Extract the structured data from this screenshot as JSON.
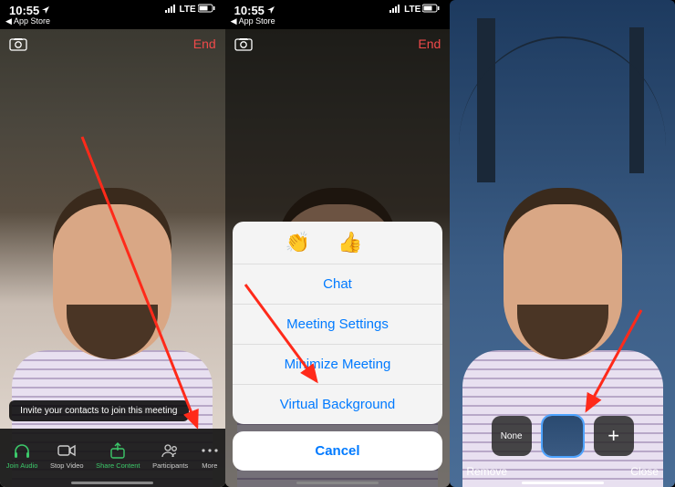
{
  "status": {
    "time": "10:55",
    "back_app": "App Store",
    "network": "LTE"
  },
  "topbar": {
    "end_label": "End"
  },
  "tooltip": "Invite your contacts to join this meeting",
  "toolbar": {
    "join_audio": "Join Audio",
    "stop_video": "Stop Video",
    "share_content": "Share Content",
    "participants": "Participants",
    "more": "More"
  },
  "sheet": {
    "emoji_clap": "👏",
    "emoji_thumbs": "👍",
    "chat": "Chat",
    "meeting_settings": "Meeting Settings",
    "minimize_meeting": "Minimize Meeting",
    "virtual_background": "Virtual Background",
    "cancel": "Cancel"
  },
  "bg_picker": {
    "none_label": "None",
    "remove_label": "Remove",
    "close_label": "Close",
    "add_glyph": "+"
  }
}
